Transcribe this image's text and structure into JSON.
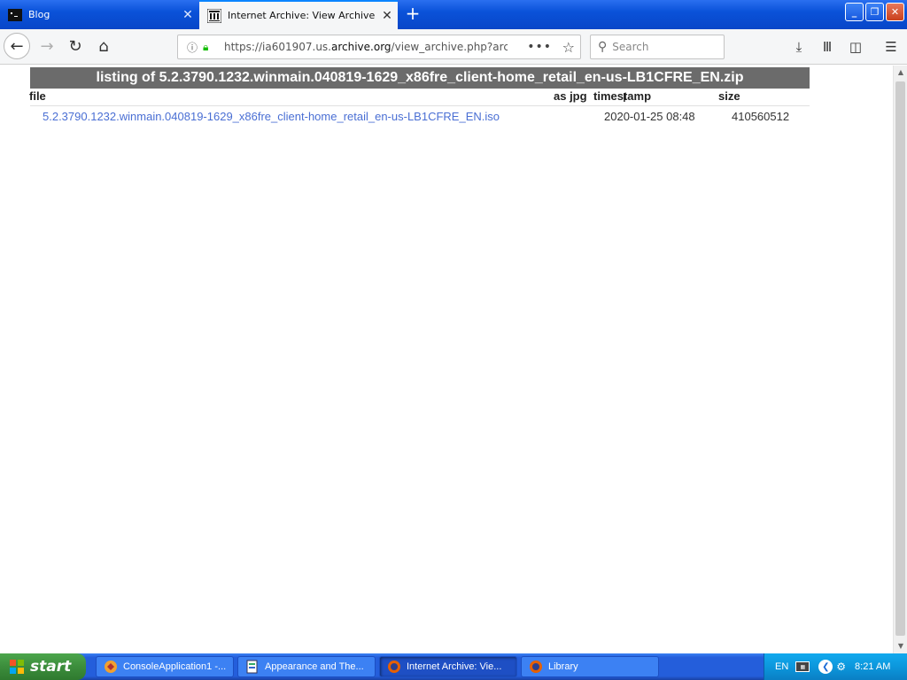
{
  "tabs": [
    {
      "title": "Blog",
      "active": false
    },
    {
      "title": "Internet Archive: View Archive",
      "active": true
    }
  ],
  "navbar": {
    "url_prefix": "https://ia601907.us.",
    "url_domain": "archive.org",
    "url_path": "/view_archive.php?arch",
    "search_placeholder": "Search"
  },
  "page": {
    "title": "listing of 5.2.3790.1232.winmain.040819-1629_x86fre_client-home_retail_en-us-LB1CFRE_EN.zip",
    "columns": {
      "file": "file",
      "as_jpg": "as jpg",
      "timestamp": "timestamp",
      "size": "size"
    },
    "rows": [
      {
        "file": "5.2.3790.1232.winmain.040819-1629_x86fre_client-home_retail_en-us-LB1CFRE_EN.iso",
        "timestamp": "2020-01-25 08:48",
        "size": "410560512"
      }
    ]
  },
  "taskbar": {
    "start_label": "start",
    "tasks": [
      {
        "label": "ConsoleApplication1 -...",
        "icon": "visual-studio-icon"
      },
      {
        "label": "Appearance and The...",
        "icon": "control-panel-icon"
      },
      {
        "label": "Internet Archive: Vie...",
        "icon": "firefox-icon",
        "active": true
      },
      {
        "label": "Library",
        "icon": "library-icon"
      }
    ],
    "tray": {
      "language": "EN",
      "clock": "8:21 AM"
    }
  },
  "colors": {
    "tabbar": "#0a52d9",
    "listing_header": "#6b6b6b",
    "link": "#4a6fd4",
    "taskbar": "#245edb",
    "start_button": "#3c8d3c"
  }
}
